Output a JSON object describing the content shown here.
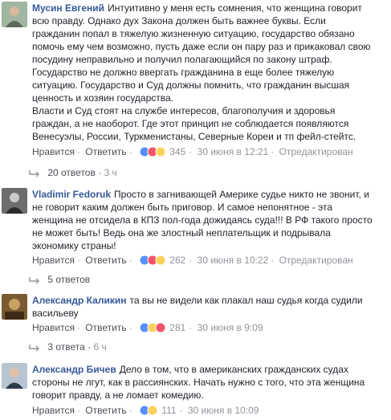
{
  "comments": [
    {
      "author": "Мусин Евгений",
      "lines": [
        "Интуитивно у меня есть сомнения, что женщина говорит",
        "всю правду. Однако дух Закона должен быть важнее буквы. Если",
        "гражданин попал в тяжелую жизненную ситуацию, государство обязано",
        "помочь ему чем возможно, пусть даже если он пару раз и прикаковал свою",
        "посудину неправильно и получил полагающийся по закону штраф.",
        "Государство не должно ввергать гражданина в еще более тяжелую",
        "ситуацию. Государство и Суд должны помнить, что гражданин высшая",
        "ценность и хозяин государства.",
        "Власти и Суд стоят на службе интересов, благополучия и здоровья",
        "граждан, а не наоборот. Где этот принцип не соблюдается появляются",
        "Венесуэлы, России, Туркменистаны, Северные Кореи и тп фейл-стейтс."
      ],
      "like_label": "Нравится",
      "reply_label": "Ответить",
      "reaction_count": "345",
      "timestamp": "30 июня в 12:21",
      "edited": "Отредактирован",
      "replies_label": "20 ответов",
      "replies_time": "3 ч"
    },
    {
      "author": "Vladimir Fedoruk",
      "lines": [
        "Просто в загнивающей Америке судье никто не звонит, и",
        "не говорит каким должен быть приговор. И самое непонятное - эта",
        "женщина не отсидела в КПЗ пол-года дожидаясь суда!!! В РФ такого просто",
        "не может быть! Ведь она же злостный неплательщик и подрывала",
        "экономику страны!"
      ],
      "like_label": "Нравится",
      "reply_label": "Ответить",
      "reaction_count": "262",
      "timestamp": "30 июня в 10:22",
      "edited": "Отредактирован",
      "replies_label": "5 ответов",
      "replies_time": ""
    },
    {
      "author": "Александр Каликин",
      "lines": [
        "та вы не видели как плакал наш судья когда судили",
        "васильеву"
      ],
      "like_label": "Нравится",
      "reply_label": "Ответить",
      "reaction_count": "281",
      "timestamp": "30 июня в 9:09",
      "edited": "",
      "replies_label": "3 ответа",
      "replies_time": "6 ч"
    },
    {
      "author": "Александр Бичев",
      "lines": [
        "Дело в том, что в американских гражданских судах",
        "стороны не лгут, как в рассиянских. Начать нужно с того, что эта женщина",
        "говорит правду, а не ломает комедию."
      ],
      "like_label": "Нравится",
      "reply_label": "Ответить",
      "reaction_count": "111",
      "timestamp": "30 июня в 10:09",
      "edited": "",
      "replies_label": "",
      "replies_time": ""
    }
  ],
  "colors": {
    "author": "#365899",
    "meta": "#90949c",
    "like_blue": "#5890ff",
    "love_red": "#f25268",
    "haha_yellow": "#fcd25a"
  }
}
